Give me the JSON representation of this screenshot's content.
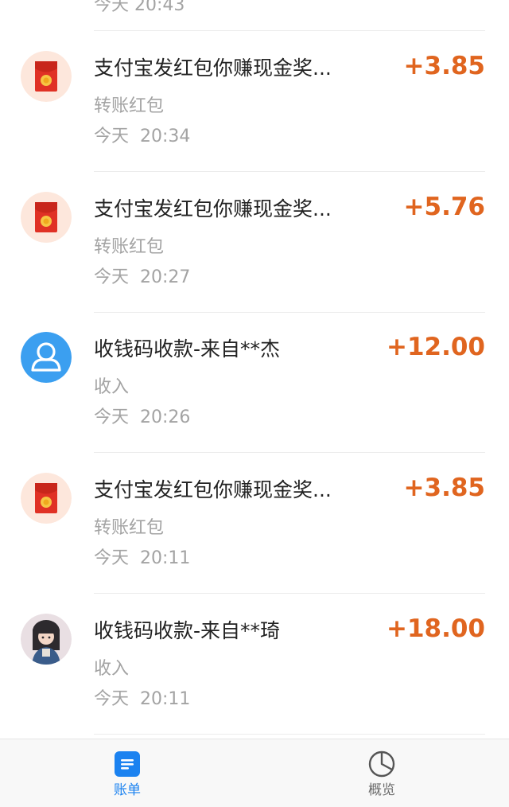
{
  "colors": {
    "amount": "#e0651f",
    "title": "#222222",
    "secondary": "#a3a3a3",
    "tab_active": "#1b82f0",
    "tab_inactive": "#6b6b6b",
    "red_packet": "#e03125",
    "user_avatar_bg": "#3b9ff0"
  },
  "partial_item": {
    "date_text": "今天  20:43"
  },
  "transactions": [
    {
      "icon": "red-envelope-icon",
      "title": "支付宝发红包你赚现金奖...",
      "amount": "+3.85",
      "category": "转账红包",
      "day": "今天",
      "time": "20:34"
    },
    {
      "icon": "red-envelope-icon",
      "title": "支付宝发红包你赚现金奖...",
      "amount": "+5.76",
      "category": "转账红包",
      "day": "今天",
      "time": "20:27"
    },
    {
      "icon": "default-user-avatar-icon",
      "title": "收钱码收款-来自**杰",
      "amount": "+12.00",
      "category": "收入",
      "day": "今天",
      "time": "20:26"
    },
    {
      "icon": "red-envelope-icon",
      "title": "支付宝发红包你赚现金奖...",
      "amount": "+3.85",
      "category": "转账红包",
      "day": "今天",
      "time": "20:11"
    },
    {
      "icon": "profile-photo-avatar",
      "title": "收钱码收款-来自**琦",
      "amount": "+18.00",
      "category": "收入",
      "day": "今天",
      "time": "20:11"
    }
  ],
  "tabbar": {
    "tabs": [
      {
        "label": "账单",
        "icon": "bill-icon",
        "active": true
      },
      {
        "label": "概览",
        "icon": "pie-chart-icon",
        "active": false
      }
    ]
  }
}
